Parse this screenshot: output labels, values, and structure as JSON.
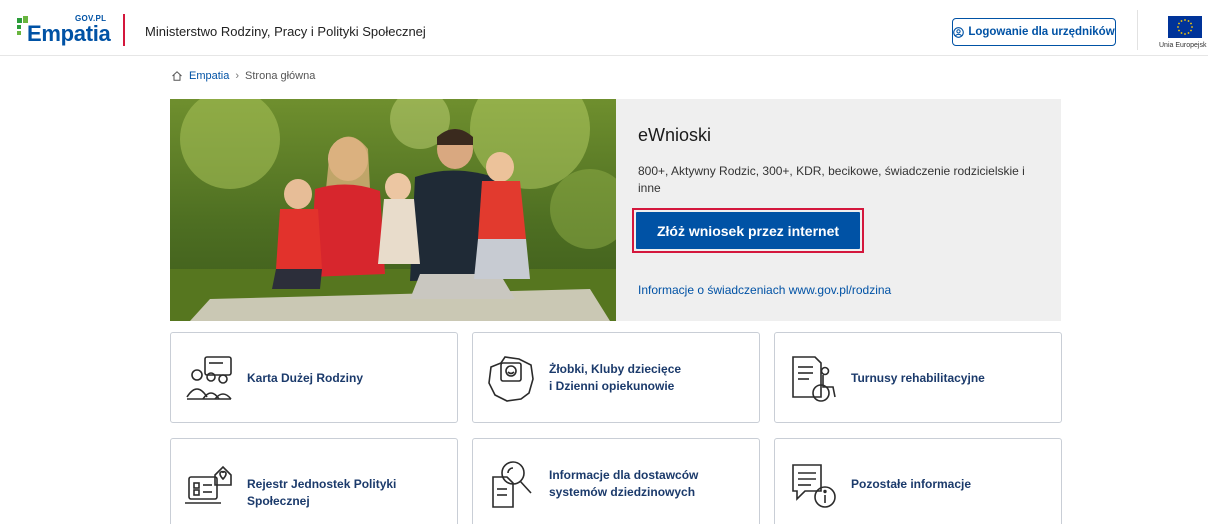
{
  "header": {
    "logo_gov": "GOV.PL",
    "logo_word": "Empatia",
    "ministry": "Ministerstwo Rodziny, Pracy i Polityki Społecznej",
    "login_label": "Logowanie dla urzędników",
    "login_icon": "user-circle-icon",
    "eu_label": "Unia Europejsk"
  },
  "breadcrumb": {
    "home_icon": "home-icon",
    "link": "Empatia",
    "separator": "›",
    "current": "Strona główna"
  },
  "hero": {
    "title": "eWnioski",
    "description": "800+, Aktywny Rodzic, 300+, KDR, becikowe, świadczenie rodzicielskie i inne",
    "apply_label": "Złóż wniosek przez internet",
    "info_link": "Informacje o świadczeniach www.gov.pl/rodzina"
  },
  "tiles": [
    {
      "label_line1": "Karta Dużej Rodziny",
      "label_line2": "",
      "icon": "family-card-icon"
    },
    {
      "label_line1": "Żłobki, Kluby dziecięce",
      "label_line2": "i Dzienni opiekunowie",
      "icon": "nursery-map-icon"
    },
    {
      "label_line1": "Turnusy rehabilitacyjne",
      "label_line2": "",
      "icon": "wheelchair-document-icon"
    },
    {
      "label_line1": "Rejestr Jednostek Polityki Społecznej",
      "label_line2": "",
      "icon": "registry-laptop-icon"
    },
    {
      "label_line1": "Informacje dla dostawców",
      "label_line2": "systemów dziedzinowych",
      "icon": "search-document-icon"
    },
    {
      "label_line1": "Pozostałe informacje",
      "label_line2": "",
      "icon": "info-document-icon"
    }
  ],
  "colors": {
    "primary_blue": "#0052a5",
    "accent_red": "#d4173c",
    "hero_bg": "#efefef"
  }
}
